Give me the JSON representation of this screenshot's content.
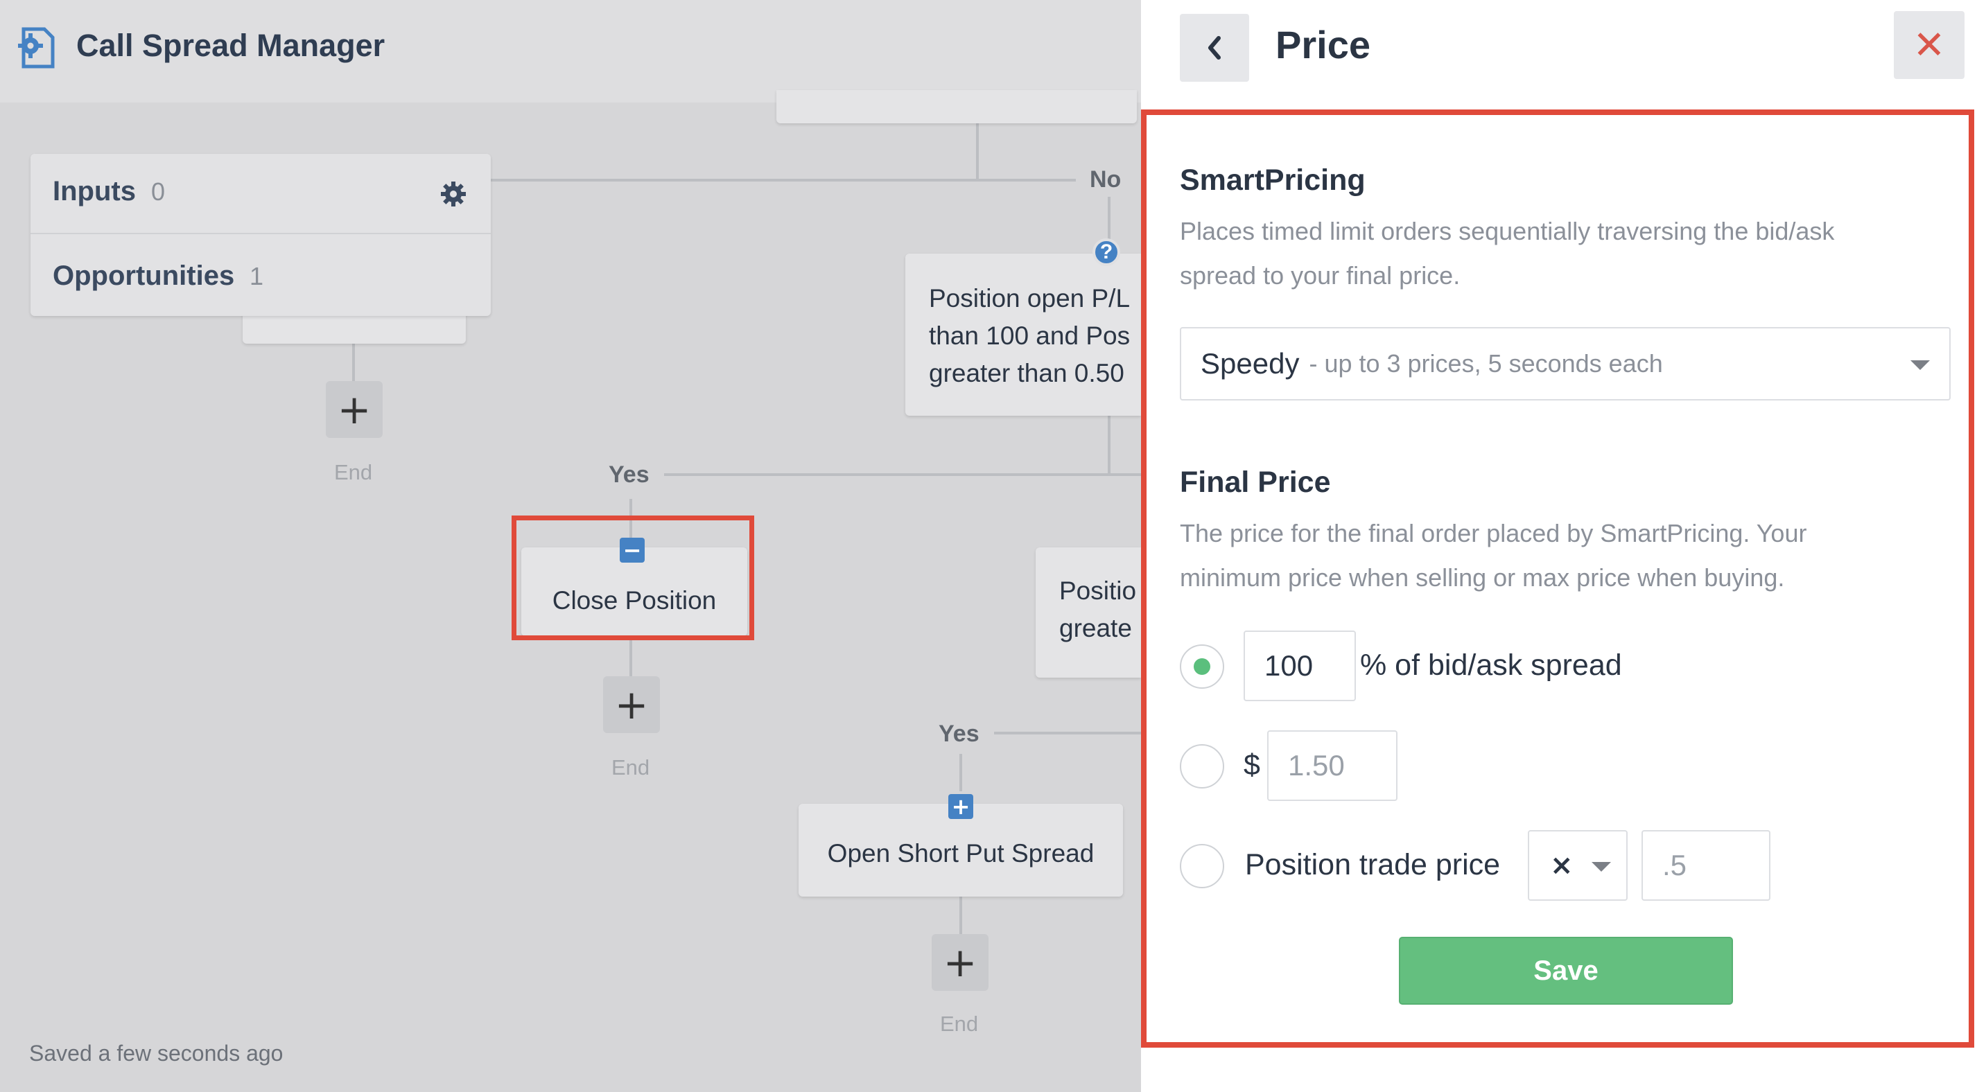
{
  "app": {
    "title": "Call Spread Manager",
    "saved_status": "Saved a few seconds ago"
  },
  "sidebar_card": {
    "inputs_label": "Inputs",
    "inputs_count": "0",
    "opportunities_label": "Opportunities",
    "opportunities_count": "1"
  },
  "flow": {
    "branch_no": "No",
    "branch_yes_1": "Yes",
    "branch_yes_2": "Yes",
    "condition_1_lines": [
      "Position open P/L",
      "than 100 and Pos",
      "greater than 0.50"
    ],
    "condition_2_lines": [
      "Positio",
      "greate"
    ],
    "close_position": "Close Position",
    "open_short_put_spread": "Open Short Put Spread",
    "add_step": "+",
    "end_label": "End",
    "close_icon_glyph": "−",
    "open_icon_glyph": "+",
    "help_icon_glyph": "?"
  },
  "panel": {
    "title": "Price",
    "close_glyph": "✕",
    "smart_pricing": {
      "title": "SmartPricing",
      "desc_lines": [
        "Places timed limit orders sequentially traversing the bid/ask",
        "spread to your final price."
      ],
      "selected_main": "Speedy",
      "selected_sub": "- up to 3 prices, 5 seconds each"
    },
    "final_price": {
      "title": "Final Price",
      "desc_lines": [
        "The price for the final order placed by SmartPricing. Your",
        "minimum price when selling or max price when buying."
      ],
      "option_percent": {
        "value": "100",
        "label": "% of bid/ask spread",
        "checked": true
      },
      "option_dollar": {
        "symbol": "$",
        "placeholder": "1.50",
        "checked": false
      },
      "option_position": {
        "label": "Position trade price",
        "operator": "×",
        "placeholder": ".5",
        "checked": false
      }
    },
    "save_label": "Save"
  },
  "colors": {
    "highlight": "#e04a3a",
    "accent_blue": "#4582c4",
    "save_green": "#64bf7f",
    "radio_green": "#5bbf7d"
  },
  "icons": [
    "settings-gear-icon",
    "gear-icon",
    "question-icon",
    "minus-square-icon",
    "plus-square-icon",
    "chevron-left-icon",
    "close-icon",
    "caret-down-icon"
  ]
}
